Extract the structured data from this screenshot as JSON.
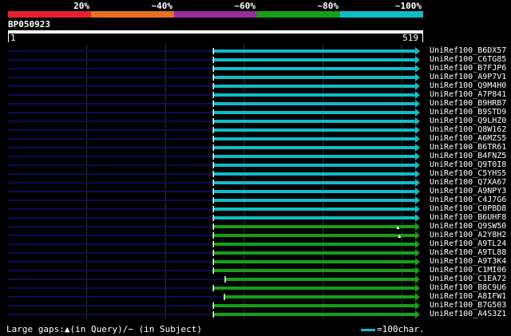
{
  "query": {
    "name": "BP050923",
    "start": "1",
    "end": "519",
    "length": 519
  },
  "identity_legend": [
    {
      "label": "20%",
      "color": "#e8202d"
    },
    {
      "label": "~40%",
      "color": "#e87020"
    },
    {
      "label": "~60%",
      "color": "#9b2d9b"
    },
    {
      "label": "~80%",
      "color": "#15a015"
    },
    {
      "label": "~100%",
      "color": "#10bcc8"
    }
  ],
  "colors": {
    "cyan": "#10bcc8",
    "green": "#15a015",
    "navy": "#0c0c54",
    "grid": "#333333",
    "triangle": "#ffffff"
  },
  "hits": [
    {
      "name": "UniRef100_B6DX57",
      "color": "cyan",
      "q_start": 260,
      "gap_marks": []
    },
    {
      "name": "UniRef100_C6TG85",
      "color": "cyan",
      "q_start": 260,
      "gap_marks": []
    },
    {
      "name": "UniRef100_B7FJP6",
      "color": "cyan",
      "q_start": 260,
      "gap_marks": []
    },
    {
      "name": "UniRef100_A9P7V1",
      "color": "cyan",
      "q_start": 260,
      "gap_marks": []
    },
    {
      "name": "UniRef100_Q9M4H0",
      "color": "cyan",
      "q_start": 260,
      "gap_marks": []
    },
    {
      "name": "UniRef100_A7P841",
      "color": "cyan",
      "q_start": 260,
      "gap_marks": []
    },
    {
      "name": "UniRef100_B9HRB7",
      "color": "cyan",
      "q_start": 260,
      "gap_marks": []
    },
    {
      "name": "UniRef100_B9STD9",
      "color": "cyan",
      "q_start": 260,
      "gap_marks": []
    },
    {
      "name": "UniRef100_Q9LHZ0",
      "color": "cyan",
      "q_start": 260,
      "gap_marks": []
    },
    {
      "name": "UniRef100_Q8W162",
      "color": "cyan",
      "q_start": 260,
      "gap_marks": []
    },
    {
      "name": "UniRef100_A6MZS5",
      "color": "cyan",
      "q_start": 260,
      "gap_marks": []
    },
    {
      "name": "UniRef100_B6TR61",
      "color": "cyan",
      "q_start": 260,
      "gap_marks": []
    },
    {
      "name": "UniRef100_B4FNZ5",
      "color": "cyan",
      "q_start": 260,
      "gap_marks": []
    },
    {
      "name": "UniRef100_Q9T0I8",
      "color": "cyan",
      "q_start": 260,
      "gap_marks": []
    },
    {
      "name": "UniRef100_C5YHS5",
      "color": "cyan",
      "q_start": 260,
      "gap_marks": []
    },
    {
      "name": "UniRef100_Q7XA67",
      "color": "cyan",
      "q_start": 260,
      "gap_marks": []
    },
    {
      "name": "UniRef100_A9NPY3",
      "color": "cyan",
      "q_start": 260,
      "gap_marks": []
    },
    {
      "name": "UniRef100_C4J7G6",
      "color": "cyan",
      "q_start": 260,
      "gap_marks": []
    },
    {
      "name": "UniRef100_C0PBD8",
      "color": "cyan",
      "q_start": 260,
      "gap_marks": []
    },
    {
      "name": "UniRef100_B6UHF8",
      "color": "cyan",
      "q_start": 260,
      "gap_marks": []
    },
    {
      "name": "UniRef100_Q9SW50",
      "color": "green",
      "q_start": 260,
      "gap_marks": [
        495
      ]
    },
    {
      "name": "UniRef100_A2Y8H2",
      "color": "green",
      "q_start": 260,
      "gap_marks": [
        497
      ]
    },
    {
      "name": "UniRef100_A9TL24",
      "color": "green",
      "q_start": 260,
      "gap_marks": []
    },
    {
      "name": "UniRef100_A9TL88",
      "color": "green",
      "q_start": 260,
      "gap_marks": []
    },
    {
      "name": "UniRef100_A9T3K4",
      "color": "green",
      "q_start": 260,
      "gap_marks": []
    },
    {
      "name": "UniRef100_C1MI06",
      "color": "green",
      "q_start": 260,
      "gap_marks": []
    },
    {
      "name": "UniRef100_C1EA72",
      "color": "green",
      "q_start": 275,
      "gap_marks": []
    },
    {
      "name": "UniRef100_B8C9U6",
      "color": "green",
      "q_start": 260,
      "gap_marks": []
    },
    {
      "name": "UniRef100_A8IFW1",
      "color": "green",
      "q_start": 274,
      "gap_marks": []
    },
    {
      "name": "UniRef100_B7G503",
      "color": "green",
      "q_start": 260,
      "gap_marks": []
    },
    {
      "name": "UniRef100_A4S3Z1",
      "color": "green",
      "q_start": 260,
      "gap_marks": []
    }
  ],
  "footer": {
    "gaps_text": "Large gaps:▲(in Query)/− (in Subject)",
    "scale_text": "=100char."
  }
}
